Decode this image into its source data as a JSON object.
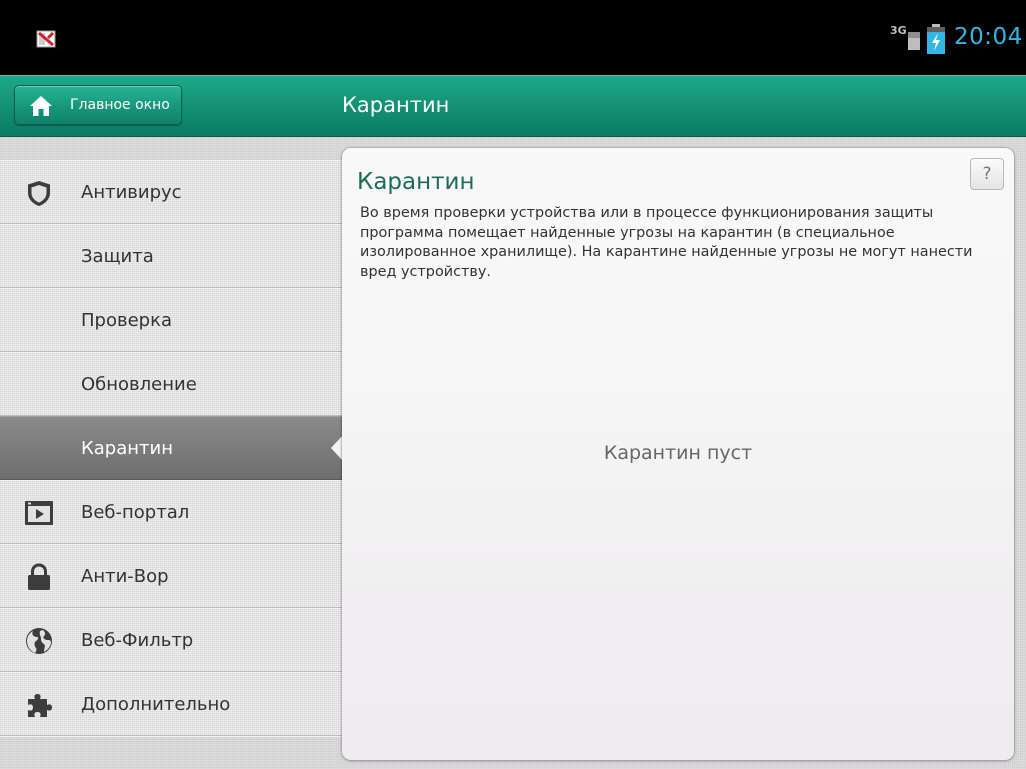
{
  "status_bar": {
    "network": "3G",
    "time": "20:04",
    "app_icon": "kaspersky-icon",
    "battery_icon": "battery-charging-icon"
  },
  "header": {
    "home_button_label": "Главное окно",
    "home_icon": "home-icon",
    "title": "Карантин"
  },
  "sidebar": {
    "items": [
      {
        "label": "Антивирус",
        "icon": "shield-icon"
      },
      {
        "label": "Защита",
        "icon": ""
      },
      {
        "label": "Проверка",
        "icon": ""
      },
      {
        "label": "Обновление",
        "icon": ""
      },
      {
        "label": "Карантин",
        "icon": "",
        "active": true
      },
      {
        "label": "Веб-портал",
        "icon": "web-portal-icon"
      },
      {
        "label": "Анти-Вор",
        "icon": "lock-icon"
      },
      {
        "label": "Веб-Фильтр",
        "icon": "globe-icon"
      },
      {
        "label": "Дополнительно",
        "icon": "puzzle-icon"
      }
    ]
  },
  "panel": {
    "help_label": "?",
    "title": "Карантин",
    "description": "Во время проверки устройства или в процессе функционирования защиты программа помещает найденные угрозы на карантин (в специальное изолированное хранилище). На карантине найденные угрозы не могут нанести вред устройству.",
    "empty_message": "Карантин пуст"
  },
  "colors": {
    "accent_green": "#138f73",
    "title_green": "#1e6a59",
    "clock_blue": "#33b5e5",
    "active_item": "#7a7a7a"
  }
}
